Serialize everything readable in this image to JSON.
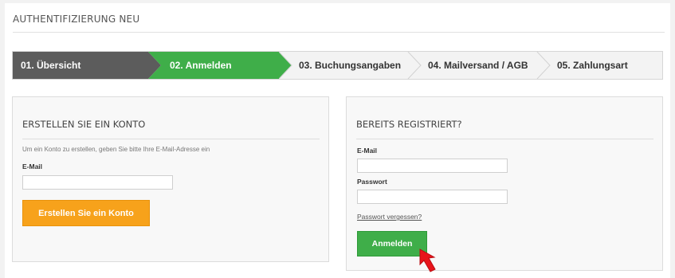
{
  "page": {
    "title": "AUTHENTIFIZIERUNG NEU"
  },
  "steps": [
    {
      "label": "01. Übersicht",
      "state": "done"
    },
    {
      "label": "02. Anmelden",
      "state": "active"
    },
    {
      "label": "03. Buchungsangaben",
      "state": "pending"
    },
    {
      "label": "04. Mailversand / AGB",
      "state": "pending"
    },
    {
      "label": "05. Zahlungsart",
      "state": "pending"
    }
  ],
  "create_account": {
    "heading": "ERSTELLEN SIE EIN KONTO",
    "hint": "Um ein Konto zu erstellen, geben Sie bitte Ihre E-Mail-Adresse ein",
    "email_label": "E-Mail",
    "email_value": "",
    "button_label": "Erstellen Sie ein Konto"
  },
  "login": {
    "heading": "BEREITS REGISTRIERT?",
    "email_label": "E-Mail",
    "email_value": "",
    "password_label": "Passwort",
    "password_value": "",
    "forgot_label": "Passwort vergessen?",
    "button_label": "Anmelden"
  },
  "colors": {
    "step_done": "#5c5c5c",
    "step_active": "#3fae49",
    "step_pending": "#f3f3f3",
    "create_button": "#f7a21b",
    "login_button": "#3fae49",
    "cursor": "#e8141a"
  },
  "icons": {
    "pointer": "red-arrow-cursor-icon"
  }
}
